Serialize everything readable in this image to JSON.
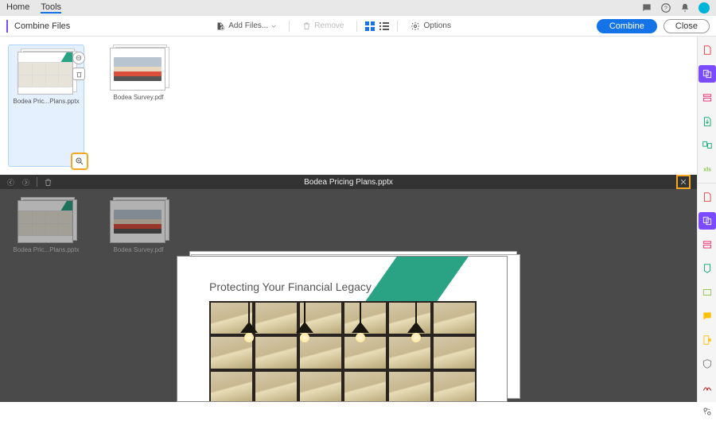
{
  "topbar": {
    "home": "Home",
    "tools": "Tools"
  },
  "toolbar": {
    "title": "Combine Files",
    "add_files": "Add Files...",
    "remove": "Remove",
    "options": "Options",
    "combine": "Combine",
    "close": "Close"
  },
  "thumbs": [
    {
      "label": "Bodea Pric...Plans.pptx"
    },
    {
      "label": "Bodea Survey.pdf"
    }
  ],
  "preview": {
    "title": "Bodea Pricing Plans.pptx",
    "doc_title": "Protecting Your Financial Legacy"
  }
}
